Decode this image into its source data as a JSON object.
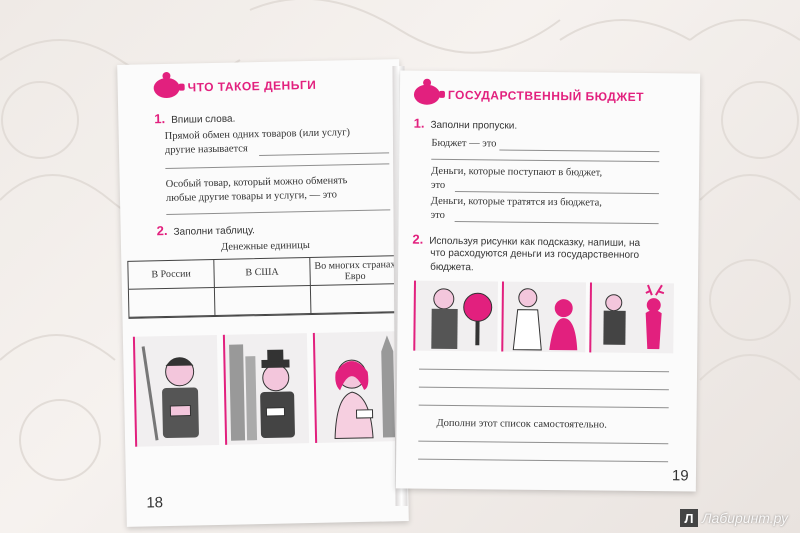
{
  "left_page": {
    "title": "ЧТО ТАКОЕ ДЕНЬГИ",
    "task1": {
      "number": "1.",
      "instruction": "Впиши слова.",
      "line1": "Прямой обмен одних товаров (или услуг)",
      "line2": "другие называется",
      "line3": "Особый товар, который можно обменять",
      "line4": "любые другие товары и услуги, — это"
    },
    "task2": {
      "number": "2.",
      "instruction": "Заполни таблицу.",
      "table_title": "Денежные единицы",
      "headers": [
        "В России",
        "В США",
        "Во многих странах Евро"
      ]
    },
    "page_number": "18"
  },
  "right_page": {
    "title": "ГОСУДАРСТВЕННЫЙ БЮДЖЕТ",
    "task1": {
      "number": "1.",
      "instruction": "Заполни пропуски.",
      "line1": "Бюджет — это",
      "line2": "Деньги, которые поступают в бюджет,",
      "line2b": "это",
      "line3": "Деньги, которые тратятся из бюджета,",
      "line3b": "это"
    },
    "task2": {
      "number": "2.",
      "instruction_l1": "Используя рисунки как подсказку, напиши, на",
      "instruction_l2": "что расходуются деньги из государственного",
      "instruction_l3": "бюджета.",
      "extra": "Дополни этот список самостоятельно."
    },
    "page_number": "19"
  },
  "watermark": {
    "letter": "Л",
    "text": "Лабиринт.ру"
  },
  "colors": {
    "accent": "#e2207e",
    "paper": "#fbfbfb",
    "background": "#efeae6"
  }
}
